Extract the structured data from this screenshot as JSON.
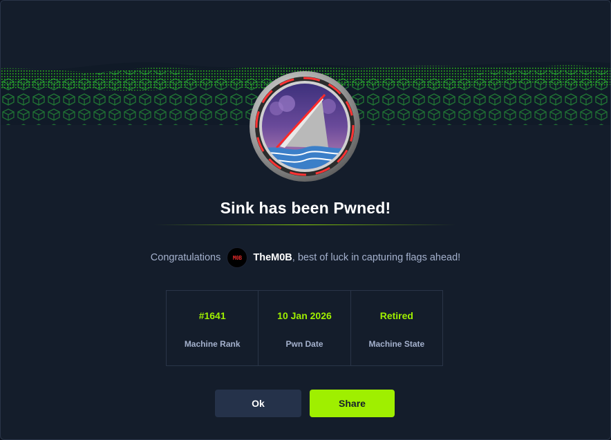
{
  "modal": {
    "title": "Sink has been Pwned!",
    "congrats_prefix": "Congratulations",
    "user_badge_text": "M0B",
    "username": "TheM0B",
    "congrats_suffix": ", best of luck in capturing flags ahead!"
  },
  "stats": [
    {
      "value": "#1641",
      "label": "Machine Rank"
    },
    {
      "value": "10 Jan 2026",
      "label": "Pwn Date"
    },
    {
      "value": "Retired",
      "label": "Machine State"
    }
  ],
  "buttons": {
    "ok_label": "Ok",
    "share_label": "Share"
  },
  "colors": {
    "accent": "#9fef00",
    "background": "#141d2b",
    "muted_text": "#a4b1cd",
    "ok_button": "#25324a"
  }
}
